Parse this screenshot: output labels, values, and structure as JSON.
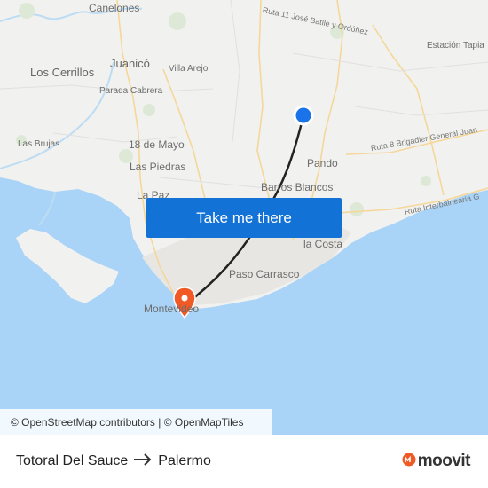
{
  "map": {
    "places": {
      "canelones": "Canelones",
      "juanico": "Juanicó",
      "los_cerrillos": "Los Cerrillos",
      "villa_arejo": "Villa Arejo",
      "parada_cabrera": "Parada Cabrera",
      "las_brujas": "Las Brujas",
      "dieciocho_de_mayo": "18 de Mayo",
      "las_piedras": "Las Piedras",
      "la_paz": "La Paz",
      "pando": "Pando",
      "barros_blancos": "Barros Blancos",
      "la_costa": "la Costa",
      "paso_carrasco": "Paso Carrasco",
      "montevideo": "Montevideo",
      "estacion_tapia": "Estación Tapia"
    },
    "roads": {
      "ruta_11": "Ruta 11 José Batlle y Ordóñez",
      "ruta_8": "Ruta 8 Brigadier General Juan",
      "ruta_interbalnearia": "Ruta Interbalnearia G"
    },
    "colors": {
      "land": "#f1f1ef",
      "water": "#a9d4f7",
      "route_line": "#222222",
      "origin_marker": "#1a73e8",
      "destination_marker": "#f15a24"
    }
  },
  "cta": {
    "label": "Take me there"
  },
  "attribution": {
    "osm": "© OpenStreetMap contributors",
    "separator": " | ",
    "omt": "© OpenMapTiles"
  },
  "footer": {
    "origin": "Totoral Del Sauce",
    "destination": "Palermo",
    "brand": "moovit",
    "brand_color": "#f15a24"
  }
}
